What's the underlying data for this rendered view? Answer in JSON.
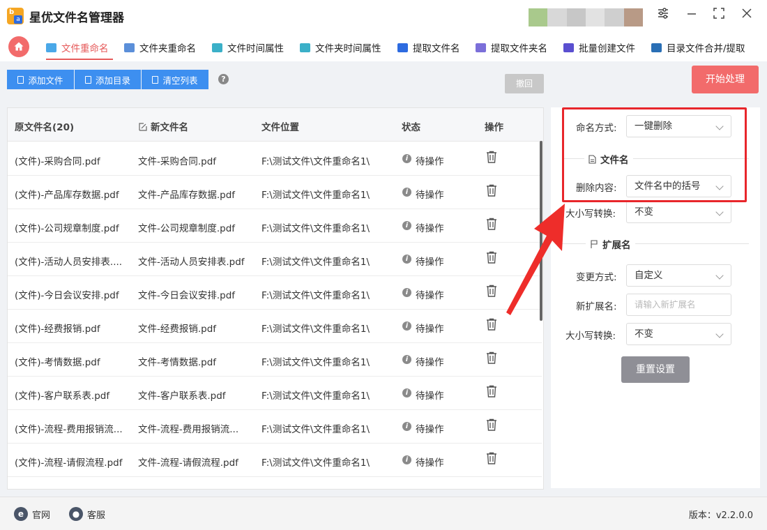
{
  "app": {
    "title": "星优文件名管理器",
    "logo_letters": [
      "b",
      "a"
    ]
  },
  "tabs": [
    {
      "label": "文件重命名",
      "active": true,
      "icon": "file-rename-icon",
      "color": "#4aa8e8"
    },
    {
      "label": "文件夹重命名",
      "icon": "folder-rename-icon",
      "color": "#5b8fd9"
    },
    {
      "label": "文件时间属性",
      "icon": "file-time-icon",
      "color": "#3bb0c8"
    },
    {
      "label": "文件夹时间属性",
      "icon": "folder-time-icon",
      "color": "#3bb0c8"
    },
    {
      "label": "提取文件名",
      "icon": "extract-filename-icon",
      "color": "#2d6be0"
    },
    {
      "label": "提取文件夹名",
      "icon": "extract-foldername-icon",
      "color": "#7b6fd9"
    },
    {
      "label": "批量创建文件",
      "icon": "batch-create-icon",
      "color": "#5a4fd0"
    },
    {
      "label": "目录文件合并/提取",
      "icon": "merge-extract-icon",
      "color": "#2a6fb5"
    }
  ],
  "toolbar": {
    "add_file": "添加文件",
    "add_dir": "添加目录",
    "clear_list": "清空列表",
    "help": "?",
    "undo": "撤回",
    "start": "开始处理"
  },
  "table": {
    "headers": {
      "original": "原文件名(20)",
      "new": "新文件名",
      "location": "文件位置",
      "status": "状态",
      "action": "操作"
    },
    "rows": [
      {
        "original": "(文件)-采购合同.pdf",
        "new": "文件-采购合同.pdf",
        "location": "F:\\测试文件\\文件重命名1\\",
        "status": "待操作"
      },
      {
        "original": "(文件)-产品库存数据.pdf",
        "new": "文件-产品库存数据.pdf",
        "location": "F:\\测试文件\\文件重命名1\\",
        "status": "待操作"
      },
      {
        "original": "(文件)-公司规章制度.pdf",
        "new": "文件-公司规章制度.pdf",
        "location": "F:\\测试文件\\文件重命名1\\",
        "status": "待操作"
      },
      {
        "original": "(文件)-活动人员安排表....",
        "new": "文件-活动人员安排表.pdf",
        "location": "F:\\测试文件\\文件重命名1\\",
        "status": "待操作"
      },
      {
        "original": "(文件)-今日会议安排.pdf",
        "new": "文件-今日会议安排.pdf",
        "location": "F:\\测试文件\\文件重命名1\\",
        "status": "待操作"
      },
      {
        "original": "(文件)-经费报销.pdf",
        "new": "文件-经费报销.pdf",
        "location": "F:\\测试文件\\文件重命名1\\",
        "status": "待操作"
      },
      {
        "original": "(文件)-考情数据.pdf",
        "new": "文件-考情数据.pdf",
        "location": "F:\\测试文件\\文件重命名1\\",
        "status": "待操作"
      },
      {
        "original": "(文件)-客户联系表.pdf",
        "new": "文件-客户联系表.pdf",
        "location": "F:\\测试文件\\文件重命名1\\",
        "status": "待操作"
      },
      {
        "original": "(文件)-流程-费用报销流...",
        "new": "文件-流程-费用报销流...",
        "location": "F:\\测试文件\\文件重命名1\\",
        "status": "待操作"
      },
      {
        "original": "(文件)-流程-请假流程.pdf",
        "new": "文件-流程-请假流程.pdf",
        "location": "F:\\测试文件\\文件重命名1\\",
        "status": "待操作"
      }
    ]
  },
  "settings": {
    "naming_mode_label": "命名方式:",
    "naming_mode_value": "一键删除",
    "filename_section": "文件名",
    "delete_content_label": "删除内容:",
    "delete_content_value": "文件名中的括号",
    "case_label": "大小写转换:",
    "case_value": "不变",
    "ext_section": "扩展名",
    "change_mode_label": "变更方式:",
    "change_mode_value": "自定义",
    "new_ext_label": "新扩展名:",
    "new_ext_placeholder": "请输入新扩展名",
    "ext_case_label": "大小写转换:",
    "ext_case_value": "不变",
    "reset": "重置设置"
  },
  "footer": {
    "website": "官网",
    "support": "客服",
    "version": "版本：v2.2.0.0"
  },
  "colors": {
    "accent_red": "#f26b6b",
    "primary_blue": "#3d8ff0",
    "highlight": "#e8262b"
  }
}
